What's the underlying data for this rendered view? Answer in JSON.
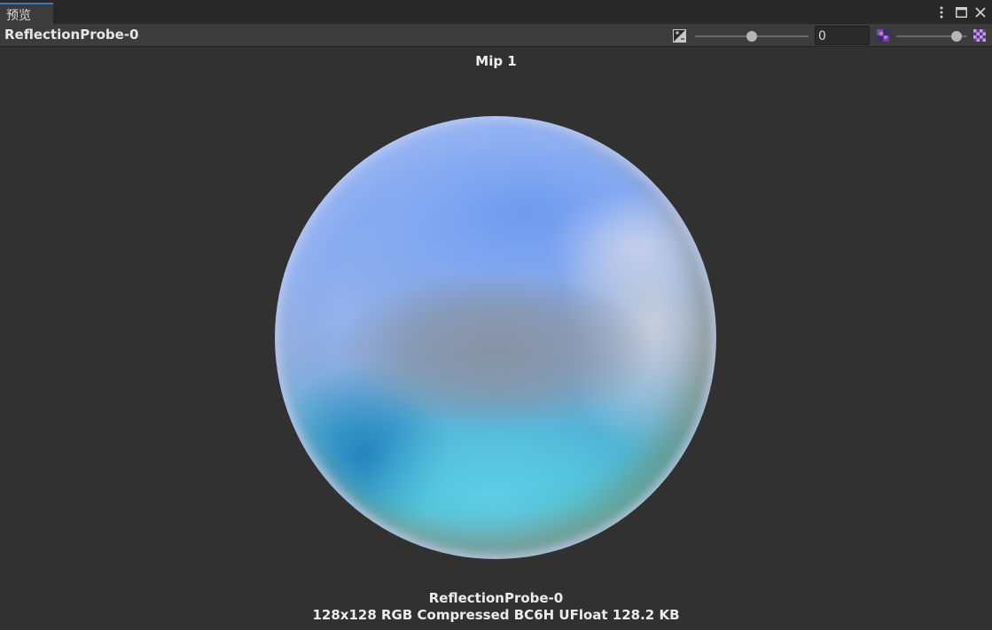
{
  "tab": {
    "label": "预览"
  },
  "toolbar": {
    "title": "ReflectionProbe-0",
    "exposure_slider_value": 0.5,
    "exposure_value": "0",
    "mip_slider_value": 0.85
  },
  "preview": {
    "mip_label": "Mip 1",
    "texture_name": "ReflectionProbe-0",
    "texture_info": "128x128  RGB Compressed BC6H UFloat   128.2 KB"
  },
  "icons": {
    "more": "more-vertical-icon",
    "maximize": "maximize-icon",
    "close": "close-icon",
    "exposure": "exposure-icon",
    "mip_small": "mip-level-small-icon",
    "mip_large": "mip-level-large-icon"
  }
}
